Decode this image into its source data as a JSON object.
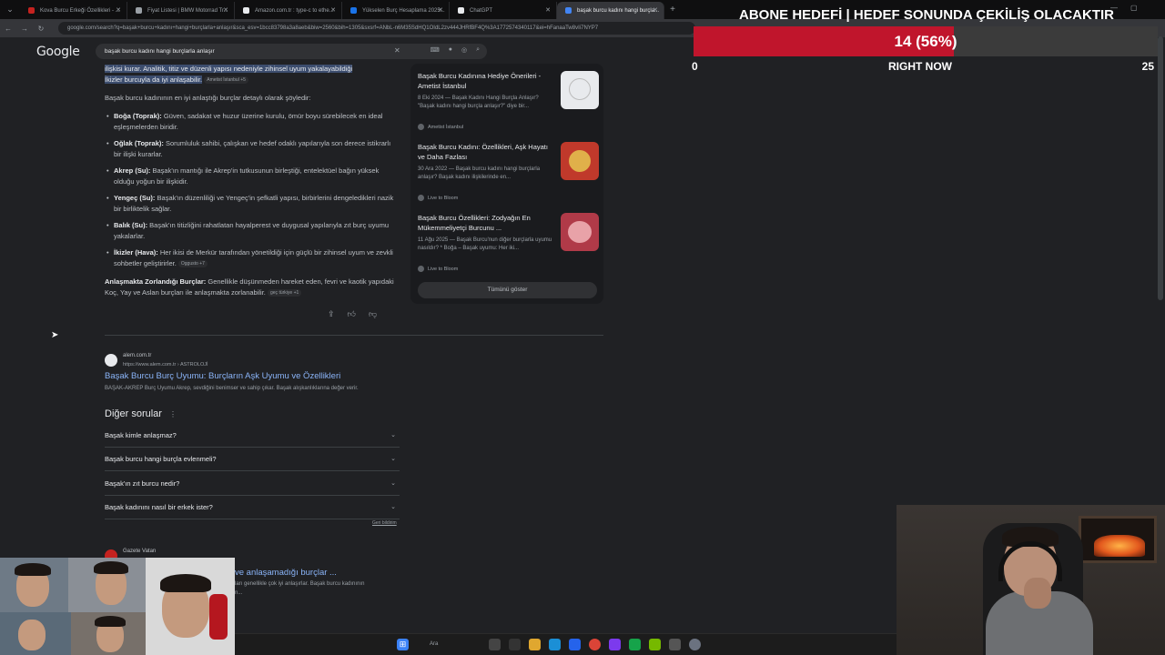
{
  "browser": {
    "tabs": [
      {
        "title": "Kova Burcu Erkeği Özellikleri - ...",
        "color": "#c5221f"
      },
      {
        "title": "Fiyat Listesi | BMW Motorrad Tr...",
        "color": "#9aa0a6"
      },
      {
        "title": "Amazon.com.tr : type-c to ethe...",
        "color": "#e8eaed"
      },
      {
        "title": "Yükselen Burç Hesaplama 2025...",
        "color": "#1a73e8"
      },
      {
        "title": "ChatGPT",
        "color": "#e8eaed"
      },
      {
        "title": "başak burcu kadını hangi burçla...",
        "color": "#4285f4"
      }
    ],
    "newtab": "+",
    "url": "google.com/search?q=başak+burcu+kadını+hangi+burçlarla+anlaşır&sca_esv=1bcc83798a3a8aeb&biw=2560&bih=1305&sxsrf=ANbL-n6M35SdHQ1OIdL2zv444JHRfBF4Q%3A1772574340117&ei=hFanaaTw8vIi7NYP7"
  },
  "google": {
    "logo": "Google",
    "query": "başak burcu kadını hangi burçlarla anlaşır"
  },
  "answer": {
    "highlight_line1": "ilişkisi kurar. Analitik, titiz ve düzenli yapısı nedeniyle zihinsel uyum yakalayabildiği",
    "highlight_line2": "İkizler burcuyla da iyi anlaşabilir.",
    "highlight_chip": "Ametist İstanbul +5",
    "intro": "Başak burcu kadınının en iyi anlaştığı burçlar detaylı olarak şöyledir:",
    "bullets": [
      {
        "name": "Boğa (Toprak):",
        "text": " Güven, sadakat ve huzur üzerine kurulu, ömür boyu sürebilecek en ideal eşleşmelerden biridir."
      },
      {
        "name": "Oğlak (Toprak):",
        "text": " Sorumluluk sahibi, çalışkan ve hedef odaklı yapılarıyla son derece istikrarlı bir ilişki kurarlar."
      },
      {
        "name": "Akrep (Su):",
        "text": " Başak'ın mantığı ile Akrep'in tutkusunun birleştiği, entelektüel bağın yüksek olduğu yoğun bir ilişkidir."
      },
      {
        "name": "Yengeç (Su):",
        "text": " Başak'ın düzenliliği ve Yengeç'in şefkatli yapısı, birbirlerini dengeledikleri nazik bir birliktelik sağlar."
      },
      {
        "name": "Balık (Su):",
        "text": " Başak'ın titizliğini rahatlatan hayalperest ve duygusal yapılarıyla zıt burç uyumu yakalarlar."
      },
      {
        "name": "İkizler (Hava):",
        "text": " Her ikisi de Merkür tarafından yönetildiği için güçlü bir zihinsel uyum ve zevkli sohbetler geliştirirler.",
        "chip": "Oggusto +7"
      }
    ],
    "difficult_label": "Anlaşmakta Zorlandığı Burçlar:",
    "difficult_text": " Genellikle düşünmeden hareket eden, fevri ve kaotik yapıdaki Koç, Yay ve Aslan burçları ile anlaşmakta zorlanabilir.",
    "difficult_chip": "geç türkiye +1"
  },
  "side_cards": [
    {
      "title": "Başak Burcu Kadınına Hediye Önerileri - Ametist İstanbul",
      "snippet": "8 Eki 2024 — Başak Kadını Hangi Burçla Anlaşır? \"Başak kadını hangi burçla anlaşır?\" diye bir...",
      "source": "Ametist İstanbul",
      "thumb": "#e8eaed"
    },
    {
      "title": "Başak Burcu Kadını: Özellikleri, Aşk Hayatı ve Daha Fazlası",
      "snippet": "30 Ara 2022 — Başak burcu kadını hangi burçlarla anlaşır? Başak kadını ilişkilerinde en...",
      "source": "Live to Bloom",
      "thumb": "#c0392b"
    },
    {
      "title": "Başak Burcu Özellikleri: Zodyağın En Mükemmeliyetçi Burcunu ...",
      "snippet": "11 Ağu 2025 — Başak Burcu'nun diğer burçlarla uyumu nasıldır? * Boğa – Başak uyumu: Her iki...",
      "source": "Live to Bloom",
      "thumb": "#b03a48"
    }
  ],
  "show_all": "Tümünü göster",
  "result": {
    "site": "alem.com.tr",
    "url": "https://www.alem.com.tr › ASTROLOJİ",
    "title": "Başak Burcu Burç Uyumu: Burçların Aşk Uyumu ve Özellikleri",
    "snippet": "BAŞAK-AKREP Burç Uyumu Akrep, sevdiğini benimser ve sahip çıkar. Başak alışkanlıklarına değer verir."
  },
  "paa": {
    "title": "Diğer sorular",
    "dots": "⋮",
    "items": [
      "Başak kimle anlaşmaz?",
      "Başak burcu hangi burçla evlenmeli?",
      "Başak'ın zıt burcu nedir?",
      "Başak kadınını nasıl bir erkek ister?"
    ],
    "feedback": "Geri bildirim"
  },
  "next_result": {
    "site": "Gazete Vatan",
    "title": "ve anlaşamadığı burçlar ...",
    "snippet": "ları genellikle çok iyi anlaşırlar. Başak burcu kadınının",
    "snippet2": "n..."
  },
  "goal": {
    "title": "ABONE HEDEFİ | HEDEF SONUNDA ÇEKİLİŞ OLACAKTIR",
    "current": 14,
    "target": 25,
    "percent": 0.56,
    "label": "14 (56%)",
    "min_label": "0",
    "mid_label": "RIGHT NOW",
    "max_label": "25",
    "fill_color": "#c0152c"
  },
  "taskbar": {
    "search_placeholder": "Ara"
  }
}
